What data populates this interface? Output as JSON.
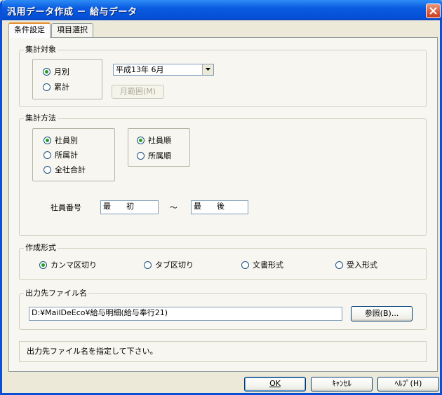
{
  "window": {
    "title": "汎用データ作成 － 給与データ"
  },
  "tabs": [
    {
      "label": "条件設定",
      "active": true
    },
    {
      "label": "項目選択",
      "active": false
    }
  ],
  "target": {
    "group_label": "集計対象",
    "options": [
      {
        "label": "月別",
        "selected": true
      },
      {
        "label": "累計",
        "selected": false
      }
    ],
    "period_value": "平成13年  6月",
    "month_range_button": "月範囲(M)"
  },
  "method": {
    "group_label": "集計方法",
    "scope_options": [
      {
        "label": "社員別",
        "selected": true
      },
      {
        "label": "所属計",
        "selected": false
      },
      {
        "label": "全社合計",
        "selected": false
      }
    ],
    "order_options": [
      {
        "label": "社員順",
        "selected": true
      },
      {
        "label": "所属順",
        "selected": false
      }
    ],
    "employee_no_label": "社員番号",
    "from_value": "最　　初",
    "range_separator": "～",
    "to_value": "最　　後"
  },
  "format": {
    "group_label": "作成形式",
    "options": [
      {
        "label": "カンマ区切り",
        "selected": true
      },
      {
        "label": "タブ区切り",
        "selected": false
      },
      {
        "label": "文書形式",
        "selected": false
      },
      {
        "label": "受入形式",
        "selected": false
      }
    ]
  },
  "output": {
    "group_label": "出力先ファイル名",
    "path_value": "D:¥MailDeEco¥給与明細(給与奉行21)",
    "browse_button": "参照(B)..."
  },
  "status_message": "出力先ファイル名を指定して下さい。",
  "buttons": {
    "ok": "OK",
    "cancel": "ｷｬﾝｾﾙ",
    "help": "ﾍﾙﾌﾟ(H)"
  },
  "colors": {
    "titlebar": "#0A5BE0",
    "dialog_bg": "#ECE9D8",
    "radio_dot": "#21A121",
    "active_tab_accent": "#E68B2C"
  }
}
